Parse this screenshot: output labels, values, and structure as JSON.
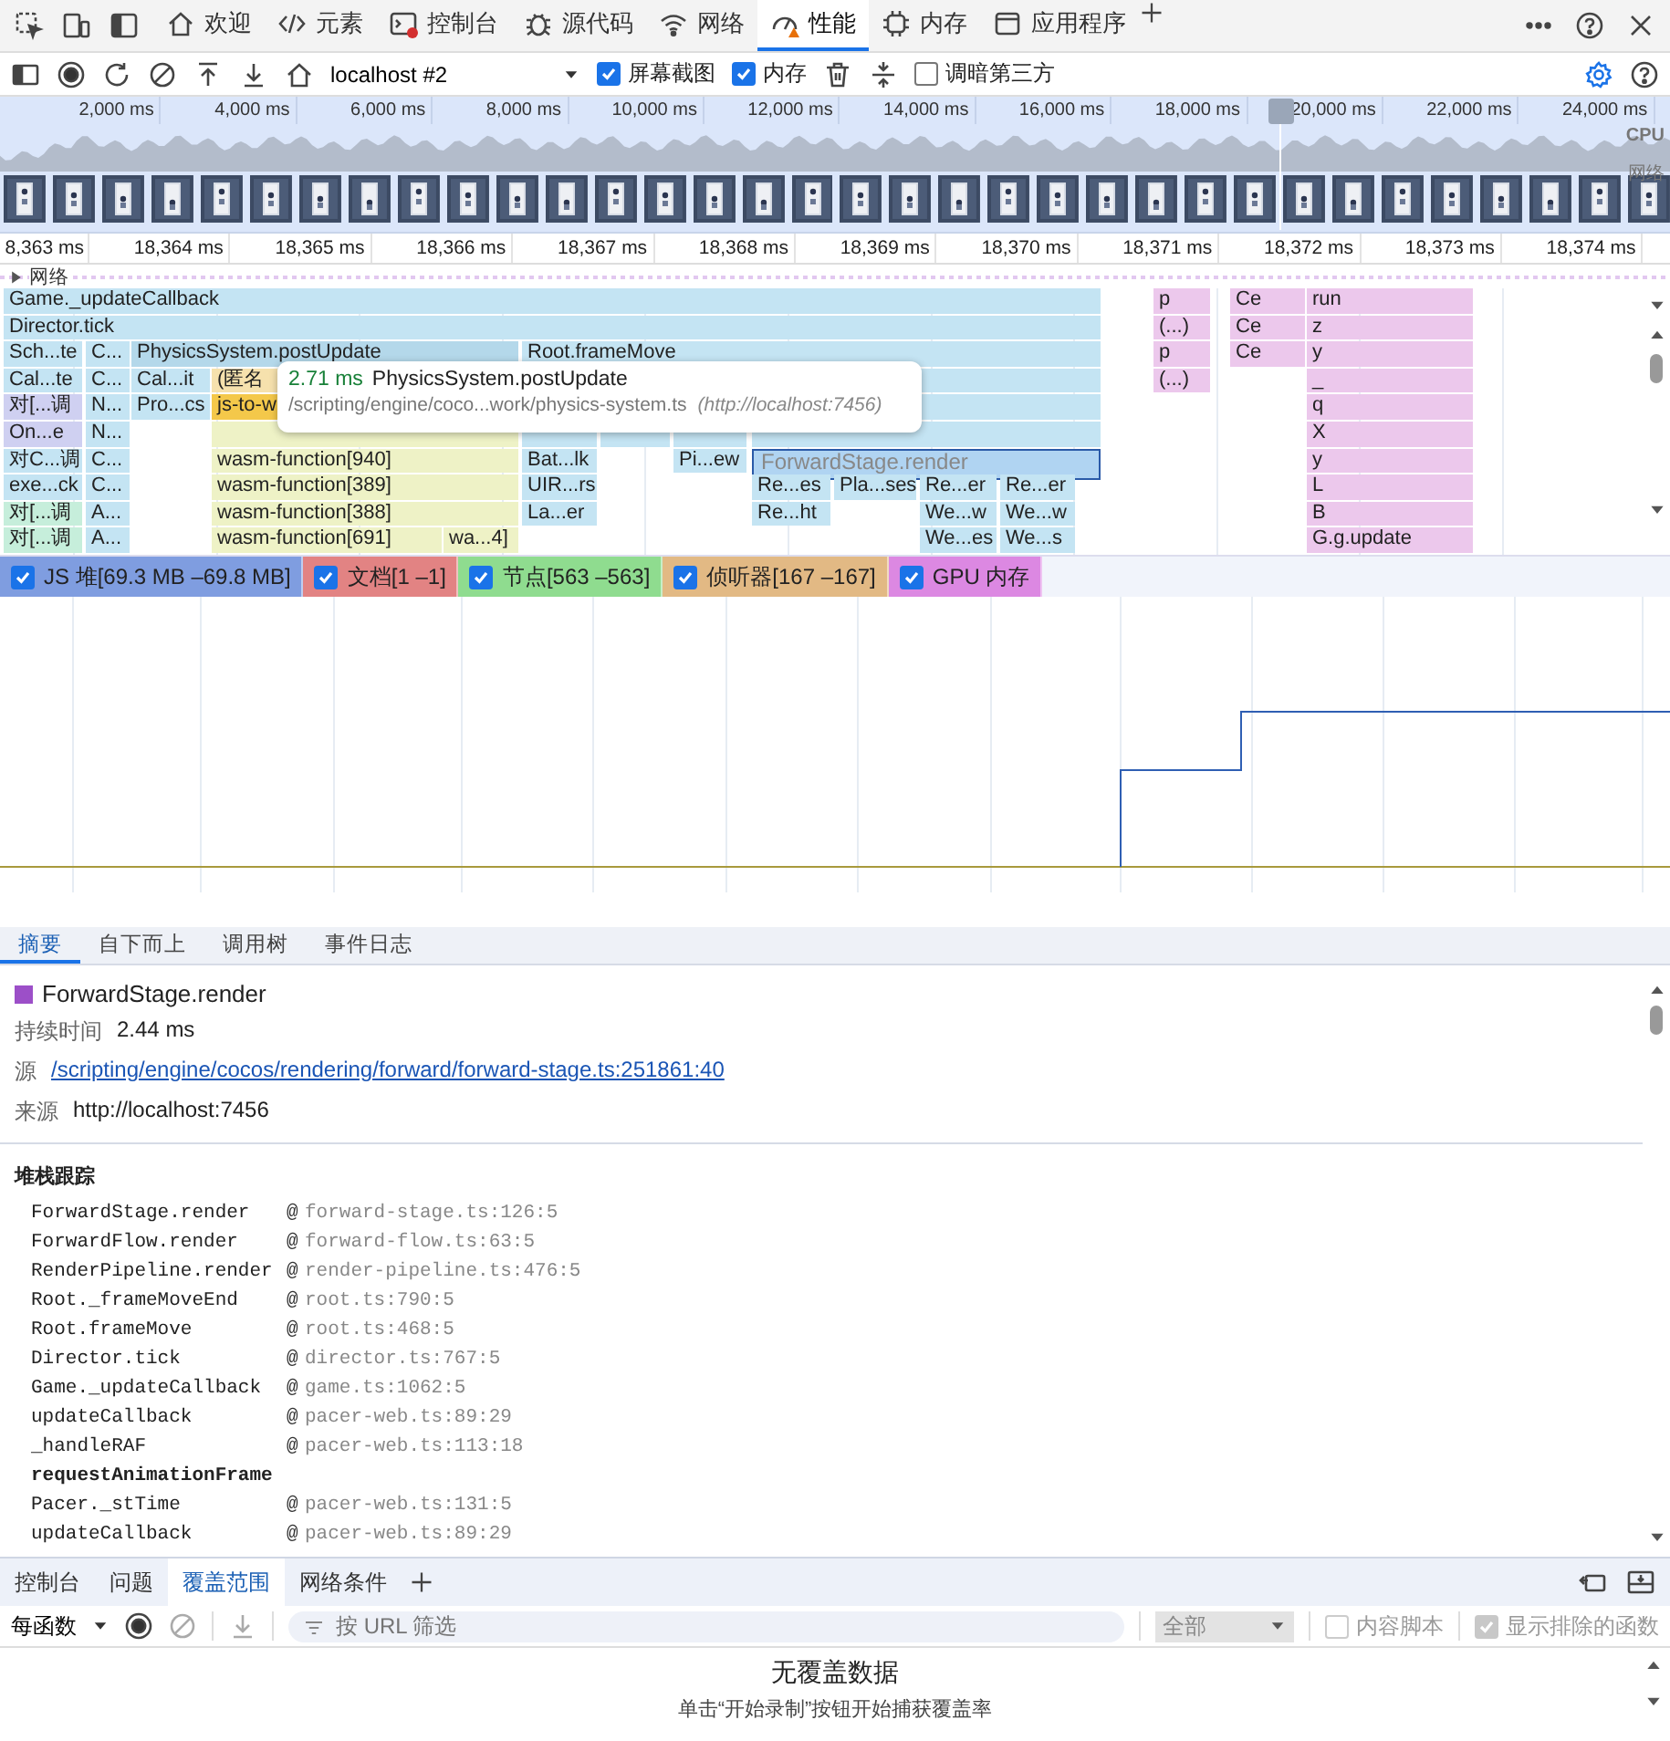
{
  "tabs": [
    {
      "label": "欢迎",
      "selected": false
    },
    {
      "label": "元素",
      "selected": false
    },
    {
      "label": "控制台",
      "selected": false
    },
    {
      "label": "源代码",
      "selected": false
    },
    {
      "label": "网络",
      "selected": false
    },
    {
      "label": "性能",
      "selected": true
    },
    {
      "label": "内存",
      "selected": false
    },
    {
      "label": "应用程序",
      "selected": false
    }
  ],
  "toolbar": {
    "target": "localhost #2",
    "checkboxes": [
      {
        "label": "屏幕截图",
        "checked": true
      },
      {
        "label": "内存",
        "checked": true
      },
      {
        "label": "调暗第三方",
        "checked": false
      }
    ]
  },
  "overview": {
    "ticks": [
      "2,000 ms",
      "4,000 ms",
      "6,000 ms",
      "8,000 ms",
      "10,000 ms",
      "12,000 ms",
      "14,000 ms",
      "16,000 ms",
      "18,000 ms",
      "20,000 ms",
      "22,000 ms",
      "24,000 ms"
    ],
    "cpu_label": "CPU",
    "network_label": "网络"
  },
  "ruler": [
    "8,363 ms",
    "18,364 ms",
    "18,365 ms",
    "18,366 ms",
    "18,367 ms",
    "18,368 ms",
    "18,369 ms",
    "18,370 ms",
    "18,371 ms",
    "18,372 ms",
    "18,373 ms",
    "18,374 ms"
  ],
  "network_track": {
    "label": "网络",
    "expanded": false
  },
  "flame": {
    "rows": [
      {
        "blocks": [
          {
            "label": "Game._updateCallback",
            "color": "#c4e4f3",
            "selected": false
          },
          {
            "label": "p",
            "color": "#ecc8ec",
            "selected": false
          },
          {
            "label": "Ce",
            "color": "#ecc8ec",
            "selected": false
          },
          {
            "label": "run",
            "color": "#ecc8ec",
            "selected": false
          }
        ]
      },
      {
        "blocks": [
          {
            "label": "Director.tick",
            "color": "#c4e4f3",
            "selected": false
          },
          {
            "label": "(...)",
            "color": "#ecc8ec",
            "selected": false
          },
          {
            "label": "Ce",
            "color": "#ecc8ec",
            "selected": false
          },
          {
            "label": "z",
            "color": "#ecc8ec",
            "selected": false
          }
        ]
      },
      {
        "blocks": [
          {
            "label": "Sch...te",
            "color": "#c4e4f3",
            "selected": false
          },
          {
            "label": "C...",
            "color": "#c4e4f3",
            "selected": false
          },
          {
            "label": "PhysicsSystem.postUpdate",
            "color": "#b4d8ea",
            "selected": false
          },
          {
            "label": "Root.frameMove",
            "color": "#c4e4f3",
            "selected": false
          },
          {
            "label": "p",
            "color": "#ecc8ec",
            "selected": false
          },
          {
            "label": "Ce",
            "color": "#ecc8ec",
            "selected": false
          },
          {
            "label": "y",
            "color": "#ecc8ec",
            "selected": false
          }
        ]
      },
      {
        "blocks": [
          {
            "label": "Cal...te",
            "color": "#c4e4f3",
            "selected": false
          },
          {
            "label": "C...",
            "color": "#c4e4f3",
            "selected": false
          },
          {
            "label": "Cal...it",
            "color": "#c4e4f3",
            "selected": false
          },
          {
            "label": "(匿名",
            "color": "#f6e1ad",
            "selected": false
          },
          {
            "color": "#c4e4f3",
            "selected": false
          },
          {
            "label": "(...)",
            "color": "#ecc8ec",
            "selected": false
          },
          {
            "label": "_",
            "color": "#ecc8ec",
            "selected": false
          }
        ]
      },
      {
        "blocks": [
          {
            "label": "对[...调",
            "color": "#cfd0f1",
            "selected": false
          },
          {
            "label": "N...",
            "color": "#c4e4f3",
            "selected": false
          },
          {
            "label": "Pro...cs",
            "color": "#c4e4f3",
            "selected": false
          },
          {
            "label": "js-to-w",
            "color": "#f4c84a",
            "selected": false
          },
          {
            "color": "#c4e4f3",
            "selected": false
          },
          {
            "label": "q",
            "color": "#ecc8ec",
            "selected": false
          }
        ]
      },
      {
        "blocks": [
          {
            "label": "On...e",
            "color": "#cfd0f1",
            "selected": false
          },
          {
            "label": "N...",
            "color": "#c4e4f3",
            "selected": false
          },
          {
            "color": "#eef2c6",
            "selected": false
          },
          {
            "color": "#c4e4f3",
            "selected": false
          },
          {
            "color": "#c4e4f3",
            "selected": false
          },
          {
            "color": "#c4e4f3",
            "selected": false
          },
          {
            "color": "#c4e4f3",
            "selected": false
          },
          {
            "label": "X",
            "color": "#ecc8ec",
            "selected": false
          }
        ]
      },
      {
        "blocks": [
          {
            "label": "对C...调",
            "color": "#c4e4f3",
            "selected": false
          },
          {
            "label": "C...",
            "color": "#c4e4f3",
            "selected": false
          },
          {
            "label": "wasm-function[940]",
            "color": "#eef2c6",
            "selected": false
          },
          {
            "label": "Bat...lk",
            "color": "#c4e4f3",
            "selected": false
          },
          {
            "label": "Pi...ew",
            "color": "#c4e4f3",
            "selected": false
          },
          {
            "label": "ForwardStage.render",
            "color": "#b0d4f2",
            "selected": true
          },
          {
            "label": "y",
            "color": "#ecc8ec",
            "selected": false
          }
        ]
      },
      {
        "blocks": [
          {
            "label": "exe...ck",
            "color": "#c4e4f3",
            "selected": false
          },
          {
            "label": "C...",
            "color": "#c4e4f3",
            "selected": false
          },
          {
            "label": "wasm-function[389]",
            "color": "#eef2c6",
            "selected": false
          },
          {
            "label": "UIR...rs",
            "color": "#c4e4f3",
            "selected": false
          },
          {
            "label": "Re...es",
            "color": "#c4e4f3",
            "selected": false
          },
          {
            "label": "Pla...ses",
            "color": "#c4e4f3",
            "selected": false
          },
          {
            "label": "Re...er",
            "color": "#c4e4f3",
            "selected": false
          },
          {
            "label": "Re...er",
            "color": "#c4e4f3",
            "selected": false
          },
          {
            "label": "L",
            "color": "#ecc8ec",
            "selected": false
          }
        ]
      },
      {
        "blocks": [
          {
            "label": "对[...调",
            "color": "#c6eedb",
            "selected": false
          },
          {
            "label": "A...",
            "color": "#c4e4f3",
            "selected": false
          },
          {
            "label": "wasm-function[388]",
            "color": "#eef2c6",
            "selected": false
          },
          {
            "label": "La...er",
            "color": "#c4e4f3",
            "selected": false
          },
          {
            "label": "Re...ht",
            "color": "#c4e4f3",
            "selected": false
          },
          {
            "label": "We...w",
            "color": "#c4e4f3",
            "selected": false
          },
          {
            "label": "We...w",
            "color": "#c4e4f3",
            "selected": false
          },
          {
            "label": "B",
            "color": "#ecc8ec",
            "selected": false
          }
        ]
      },
      {
        "blocks": [
          {
            "label": "对[...调",
            "color": "#c6eedb",
            "selected": false
          },
          {
            "label": "A...",
            "color": "#c4e4f3",
            "selected": false
          },
          {
            "label": "wasm-function[691]",
            "color": "#eef2c6",
            "selected": false
          },
          {
            "label": "wa...4]",
            "color": "#eef2c6",
            "selected": false
          },
          {
            "label": "We...es",
            "color": "#c4e4f3",
            "selected": false
          },
          {
            "label": "We...s",
            "color": "#c4e4f3",
            "selected": false
          },
          {
            "label": "G.g.update",
            "color": "#ecc8ec",
            "selected": false
          }
        ]
      }
    ],
    "tooltip": {
      "duration": "2.71 ms",
      "name": "PhysicsSystem.postUpdate",
      "path": "/scripting/engine/coco...work/physics-system.ts",
      "origin": "(http://localhost:7456)"
    }
  },
  "memory_counters": [
    {
      "label": "JS 堆[69.3 MB –69.8 MB]",
      "checked": true,
      "color": "#7f9de0"
    },
    {
      "label": "文档[1 –1]",
      "checked": true,
      "color": "#e28383"
    },
    {
      "label": "节点[563 –563]",
      "checked": true,
      "color": "#8fdc8f"
    },
    {
      "label": "侦听器[167 –167]",
      "checked": true,
      "color": "#e2b984"
    },
    {
      "label": "GPU 内存",
      "checked": true,
      "color": "#dc88e2"
    }
  ],
  "summary_tabs": [
    {
      "label": "摘要",
      "selected": true
    },
    {
      "label": "自下而上",
      "selected": false
    },
    {
      "label": "调用树",
      "selected": false
    },
    {
      "label": "事件日志",
      "selected": false
    }
  ],
  "summary": {
    "title": "ForwardStage.render",
    "color": "#9c4fc8",
    "duration_label": "持续时间",
    "duration": "2.44 ms",
    "source_label": "源",
    "source": "/scripting/engine/cocos/rendering/forward/forward-stage.ts:251861:40",
    "origin_label": "来源",
    "origin": "http://localhost:7456",
    "stack_title": "堆栈跟踪",
    "stack": [
      {
        "kind": "frame",
        "function": "ForwardStage.render",
        "at": "@",
        "location": "forward-stage.ts:126:5"
      },
      {
        "kind": "frame",
        "function": "ForwardFlow.render",
        "at": "@",
        "location": "forward-flow.ts:63:5"
      },
      {
        "kind": "frame",
        "function": "RenderPipeline.render",
        "at": "@",
        "location": "render-pipeline.ts:476:5"
      },
      {
        "kind": "frame",
        "function": "Root._frameMoveEnd",
        "at": "@",
        "location": "root.ts:790:5"
      },
      {
        "kind": "frame",
        "function": "Root.frameMove",
        "at": "@",
        "location": "root.ts:468:5"
      },
      {
        "kind": "frame",
        "function": "Director.tick",
        "at": "@",
        "location": "director.ts:767:5"
      },
      {
        "kind": "frame",
        "function": "Game._updateCallback",
        "at": "@",
        "location": "game.ts:1062:5"
      },
      {
        "kind": "frame",
        "function": "updateCallback",
        "at": "@",
        "location": "pacer-web.ts:89:29"
      },
      {
        "kind": "frame",
        "function": "_handleRAF",
        "at": "@",
        "location": "pacer-web.ts:113:18"
      },
      {
        "kind": "async",
        "function": "requestAnimationFrame"
      },
      {
        "kind": "frame",
        "function": "Pacer._stTime",
        "at": "@",
        "location": "pacer-web.ts:131:5"
      },
      {
        "kind": "frame",
        "function": "updateCallback",
        "at": "@",
        "location": "pacer-web.ts:89:29"
      }
    ]
  },
  "drawer": {
    "tabs": [
      {
        "label": "控制台",
        "selected": false
      },
      {
        "label": "问题",
        "selected": false
      },
      {
        "label": "覆盖范围",
        "selected": true
      },
      {
        "label": "网络条件",
        "selected": false
      }
    ],
    "mode": "每函数",
    "filter_placeholder": "按 URL 筛选",
    "type_select": "全部",
    "options": [
      {
        "label": "内容脚本",
        "checked": false,
        "disabled": true
      },
      {
        "label": "显示排除的函数",
        "checked": true,
        "disabled": true
      }
    ],
    "empty_title": "无覆盖数据",
    "empty_hint": "单击“开始录制”按钮开始捕获覆盖率"
  }
}
